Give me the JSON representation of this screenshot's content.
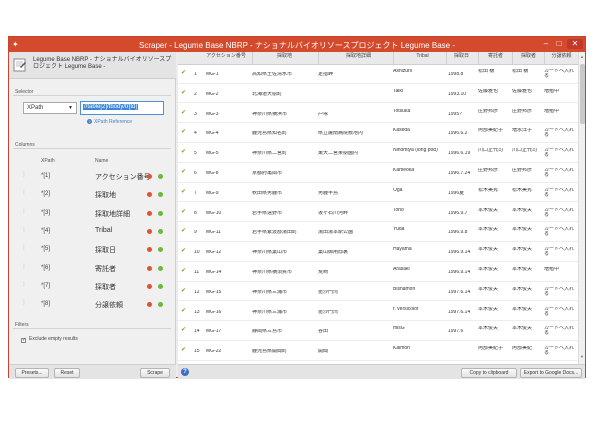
{
  "window": {
    "title": "Scraper - Legume Base NBRP - ナショナルバイオリソースプロジェクト Legume Base -",
    "app_icon": "puzzle-icon",
    "controls": [
      "–",
      "□",
      "✕"
    ]
  },
  "sidebar": {
    "header_title": "Legume Base NBRP - ナショナルバイオリソースプロジェクト Legume Base -",
    "selector": {
      "section_label": "Selector",
      "type": "XPath",
      "value": "//table[2]/tbody/tr[td]",
      "reference_link": "XPath Reference"
    },
    "columns": {
      "section_label": "Columns",
      "head_xpath": "XPath",
      "head_name": "Name",
      "items": [
        {
          "xpath": "*[1]",
          "name": "アクセション番号"
        },
        {
          "xpath": "*[2]",
          "name": "採取地"
        },
        {
          "xpath": "*[3]",
          "name": "採取地詳細"
        },
        {
          "xpath": "*[4]",
          "name": "Tribal"
        },
        {
          "xpath": "*[5]",
          "name": "採取日"
        },
        {
          "xpath": "*[6]",
          "name": "寄託者"
        },
        {
          "xpath": "*[7]",
          "name": "採取者"
        },
        {
          "xpath": "*[8]",
          "name": "分譲依頼"
        }
      ]
    },
    "filters": {
      "section_label": "Filters",
      "exclude_empty": "Exclude empty results",
      "checkmark": "✓"
    },
    "buttons": {
      "presets": "Presets...",
      "reset": "Reset",
      "scrape": "Scrape"
    }
  },
  "table": {
    "headers": [
      "",
      "アクセション番号",
      "採取地",
      "採取地詳細",
      "Tribal",
      "採取日",
      "寄託者",
      "採取者",
      "分譲依頼"
    ],
    "rows": [
      {
        "n": "1",
        "acc": "MG-1",
        "place": "高知県土佐清水市",
        "detail": "足摺岬",
        "tribal": "Ashizurii",
        "date": "1998.8",
        "dep": "松田 穣",
        "col": "松田 穣",
        "req": "カートへ入れる"
      },
      {
        "n": "2",
        "acc": "MG-2",
        "place": "北海道大樹町",
        "detail": "",
        "tribal": "Taiki",
        "date": "1993.10",
        "dep": "佐藤雅也",
        "col": "佐藤雅也",
        "req": "増殖中"
      },
      {
        "n": "3",
        "acc": "MG-3",
        "place": "神奈川県横浜市",
        "detail": "戸塚",
        "tribal": "Totsuka",
        "date": "1995?",
        "dep": "庄野邦彦",
        "col": "庄野邦彦",
        "req": "増殖中"
      },
      {
        "n": "4",
        "acc": "MG-4",
        "place": "鹿児島県知名町",
        "detail": "県立薩南病院敷地内",
        "tribal": "Kaseda",
        "date": "1996.6.2",
        "dep": "阿部美紀子",
        "col": "増永洋子",
        "req": "カートへ入れる"
      },
      {
        "n": "5",
        "acc": "MG-5",
        "place": "神奈川県二宮町",
        "detail": "東大二宮果樹園内",
        "tribal": "Ninomiya (long pod)",
        "date": "1996.6.19",
        "dep": "川口正代司",
        "col": "川口正代司",
        "req": "カートへ入れる"
      },
      {
        "n": "6",
        "acc": "MG-8",
        "place": "京都府亀岡市",
        "detail": "",
        "tribal": "Kameoka",
        "date": "1996.7.24",
        "dep": "庄野邦彦",
        "col": "庄野邦彦",
        "req": "カートへ入れる"
      },
      {
        "n": "7",
        "acc": "MG-9",
        "place": "秋田県男鹿市",
        "detail": "男鹿半島",
        "tribal": "Oga",
        "date": "1996夏",
        "dep": "松木美秀",
        "col": "松木美秀",
        "req": "カートへ入れる"
      },
      {
        "n": "8",
        "acc": "MG-10",
        "place": "岩手県遠野市",
        "detail": "坂ヶ石川河畔",
        "tribal": "Tono",
        "date": "1996.9.7",
        "dep": "本木俊夫",
        "col": "本木俊夫",
        "req": "カートへ入れる"
      },
      {
        "n": "9",
        "acc": "MG-11",
        "place": "岩手県紫波郡湯田町",
        "detail": "湯田湯本駅公園",
        "tribal": "Yuda",
        "date": "1996.9.8",
        "dep": "本木俊夫",
        "col": "本木俊夫",
        "req": "カートへ入れる"
      },
      {
        "n": "10",
        "acc": "MG-12",
        "place": "神奈川県葉山市",
        "detail": "葉山御用邸裏",
        "tribal": "Hayama",
        "date": "1996.9.14",
        "dep": "本木俊夫",
        "col": "本木俊夫",
        "req": "カートへ入れる"
      },
      {
        "n": "11",
        "acc": "MG-14",
        "place": "神奈川県横須賀市",
        "detail": "荒崎",
        "tribal": "Arasaki",
        "date": "1996.9.14",
        "dep": "本木俊夫",
        "col": "本木俊夫",
        "req": "増殖中"
      },
      {
        "n": "12",
        "acc": "MG-15",
        "place": "神奈川県三浦市",
        "detail": "毘沙門湾",
        "tribal": "Bishamon",
        "date": "1997.6.14",
        "dep": "本木俊夫",
        "col": "本木俊夫",
        "req": "カートへ入れる"
      },
      {
        "n": "13",
        "acc": "MG-16",
        "place": "神奈川県三浦市",
        "detail": "毘沙門湾",
        "tribal": "f. versicolor",
        "date": "1997.6.14",
        "dep": "本木俊夫",
        "col": "本木俊夫",
        "req": "カートへ入れる"
      },
      {
        "n": "14",
        "acc": "MG-17",
        "place": "静岡県三島市",
        "detail": "谷田",
        "tribal": "misG",
        "date": "1997.6",
        "dep": "本木俊夫",
        "col": "本木俊夫",
        "req": "カートへ入れる"
      },
      {
        "n": "15",
        "acc": "MG-22",
        "place": "鹿児島県開聞町",
        "detail": "開聞",
        "tribal": "Kaimon",
        "date": "",
        "dep": "阿部美紀子",
        "col": "阿部美紀",
        "req": "カートへ入れる"
      }
    ]
  },
  "footer": {
    "copy": "Copy to clipboard",
    "export": "Export to Google Docs..."
  },
  "colors": {
    "titlebar": "#d44a2c",
    "check": "#6aaa2c",
    "remove": "#e2522e",
    "add": "#6cb83a",
    "selection": "#3b86d8"
  }
}
